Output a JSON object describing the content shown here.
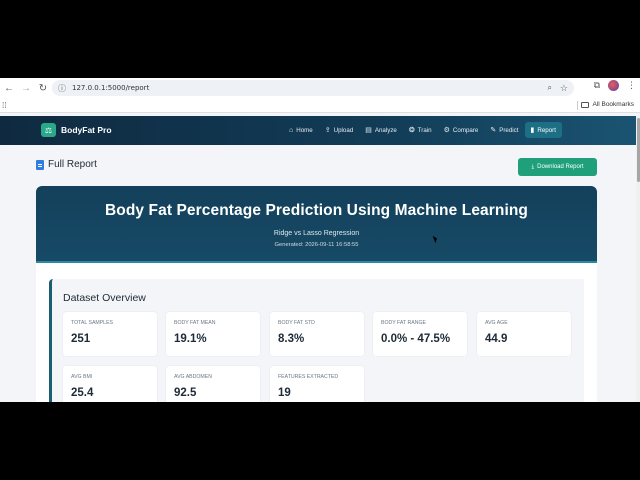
{
  "browser": {
    "url": "127.0.0.1:5000/report",
    "bookmarks_label": "All Bookmarks"
  },
  "nav": {
    "brand": "BodyFat Pro",
    "items": [
      {
        "label": "Home",
        "icon": "home-icon"
      },
      {
        "label": "Upload",
        "icon": "upload-icon"
      },
      {
        "label": "Analyze",
        "icon": "chart-icon"
      },
      {
        "label": "Train",
        "icon": "brain-icon"
      },
      {
        "label": "Compare",
        "icon": "compare-icon"
      },
      {
        "label": "Predict",
        "icon": "wand-icon"
      },
      {
        "label": "Report",
        "icon": "file-icon",
        "active": true
      }
    ]
  },
  "page": {
    "title": "Full Report",
    "download_label": "Download Report"
  },
  "hero": {
    "title": "Body Fat Percentage Prediction Using Machine Learning",
    "subtitle": "Ridge vs Lasso Regression",
    "generated": "Generated: 2026-09-11 16:58:55"
  },
  "overview": {
    "title": "Dataset Overview",
    "stats": [
      {
        "label": "TOTAL SAMPLES",
        "value": "251"
      },
      {
        "label": "BODY FAT MEAN",
        "value": "19.1%"
      },
      {
        "label": "BODY FAT STD",
        "value": "8.3%"
      },
      {
        "label": "BODY FAT RANGE",
        "value": "0.0% - 47.5%"
      },
      {
        "label": "AVG AGE",
        "value": "44.9"
      },
      {
        "label": "AVG BMI",
        "value": "25.4"
      },
      {
        "label": "AVG ABDOMEN",
        "value": "92.5"
      },
      {
        "label": "FEATURES EXTRACTED",
        "value": "19"
      }
    ]
  },
  "colors": {
    "accent": "#1fa07a",
    "nav_bg": "#123c57",
    "hero_bg": "#164a66"
  }
}
